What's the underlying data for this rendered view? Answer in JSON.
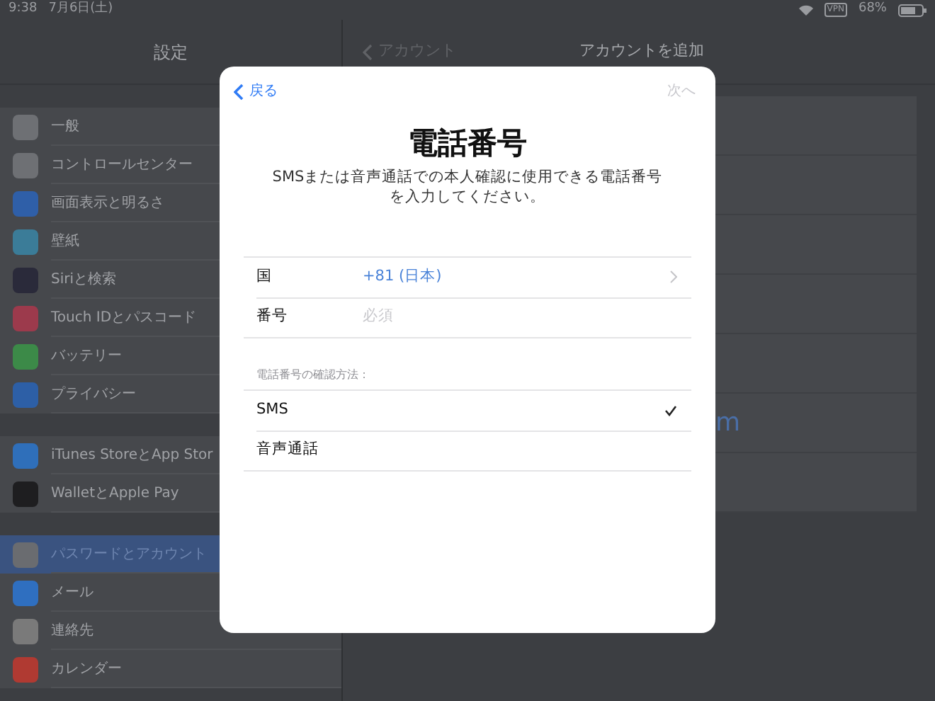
{
  "status_bar": {
    "time": "9:38",
    "date": "7月6日(土)",
    "vpn": "VPN",
    "battery": "68%"
  },
  "sidebar": {
    "title": "設定",
    "groups": [
      [
        {
          "label": "一般",
          "color": "#6e7074",
          "selected": false
        },
        {
          "label": "コントロールセンター",
          "color": "#6e7074",
          "selected": false
        },
        {
          "label": "画面表示と明るさ",
          "color": "#2f5fa8",
          "selected": false
        },
        {
          "label": "壁紙",
          "color": "#3b7c98",
          "selected": false
        },
        {
          "label": "Siriと検索",
          "color": "#2a2a3a",
          "selected": false
        },
        {
          "label": "Touch IDとパスコード",
          "color": "#9c3a4c",
          "selected": false
        },
        {
          "label": "バッテリー",
          "color": "#3c8a48",
          "selected": false
        },
        {
          "label": "プライバシー",
          "color": "#2d5fa6",
          "selected": false
        }
      ],
      [
        {
          "label": "iTunes StoreとApp Stor",
          "color": "#2f6fba",
          "selected": false
        },
        {
          "label": "WalletとApple Pay",
          "color": "#1e1e20",
          "selected": false
        }
      ],
      [
        {
          "label": "パスワードとアカウント",
          "color": "#6a6c70",
          "selected": true
        },
        {
          "label": "メール",
          "color": "#2f6fc0",
          "selected": false
        },
        {
          "label": "連絡先",
          "color": "#7a7a7a",
          "selected": false
        },
        {
          "label": "カレンダー",
          "color": "#b03a32",
          "selected": false
        }
      ]
    ]
  },
  "detail": {
    "back": "アカウント",
    "title": "アカウントを追加",
    "row_text": "m"
  },
  "modal": {
    "back": "戻る",
    "next": "次へ",
    "next_disabled": true,
    "title": "電話番号",
    "subtitle": [
      "SMSまたは音声通話での本人確認に使用できる電話番号",
      "を入力してください。"
    ],
    "fields": [
      {
        "label": "国",
        "value": "+81 (日本)",
        "kind": "picker"
      },
      {
        "label": "番号",
        "placeholder": "必須",
        "kind": "input"
      }
    ],
    "method_header": "電話番号の確認方法：",
    "methods": [
      {
        "label": "SMS",
        "selected": true
      },
      {
        "label": "音声通話",
        "selected": false
      }
    ]
  }
}
